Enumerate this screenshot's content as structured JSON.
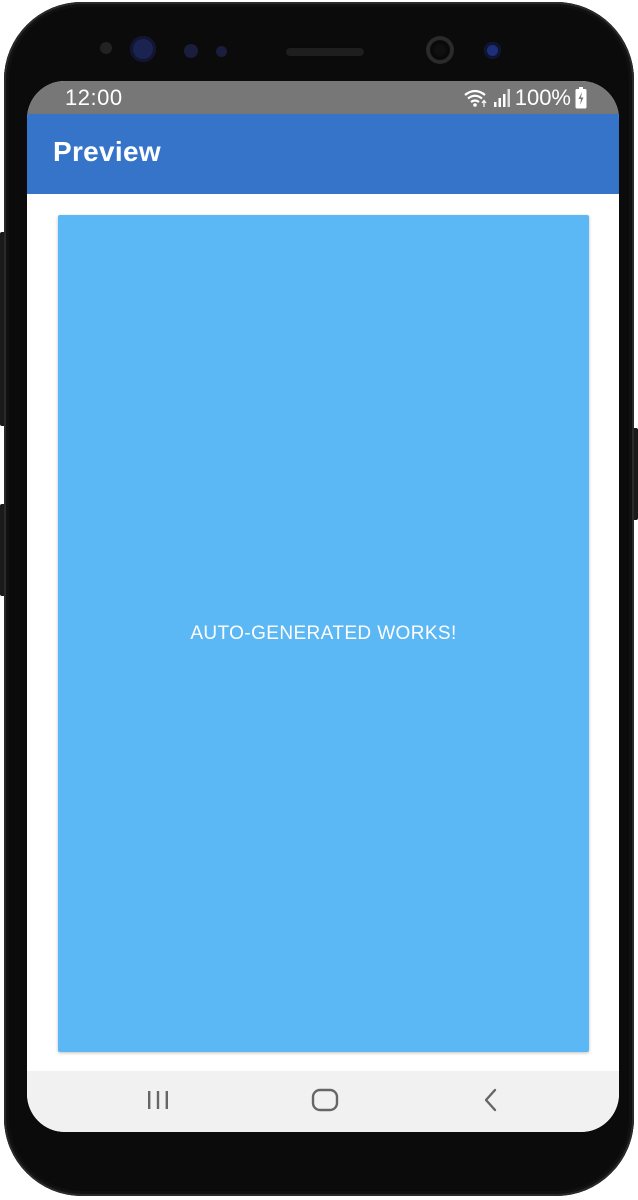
{
  "status_bar": {
    "time": "12:00",
    "battery": "100%",
    "icons": [
      "wifi-icon",
      "signal-icon",
      "battery-charging-icon"
    ]
  },
  "app_bar": {
    "title": "Preview",
    "color": "#3574c9"
  },
  "card": {
    "text": "AUTO-GENERATED WORKS!",
    "color": "#5bb8f5"
  },
  "nav_bar": {
    "buttons": [
      "recents-icon",
      "home-icon",
      "back-icon"
    ]
  }
}
